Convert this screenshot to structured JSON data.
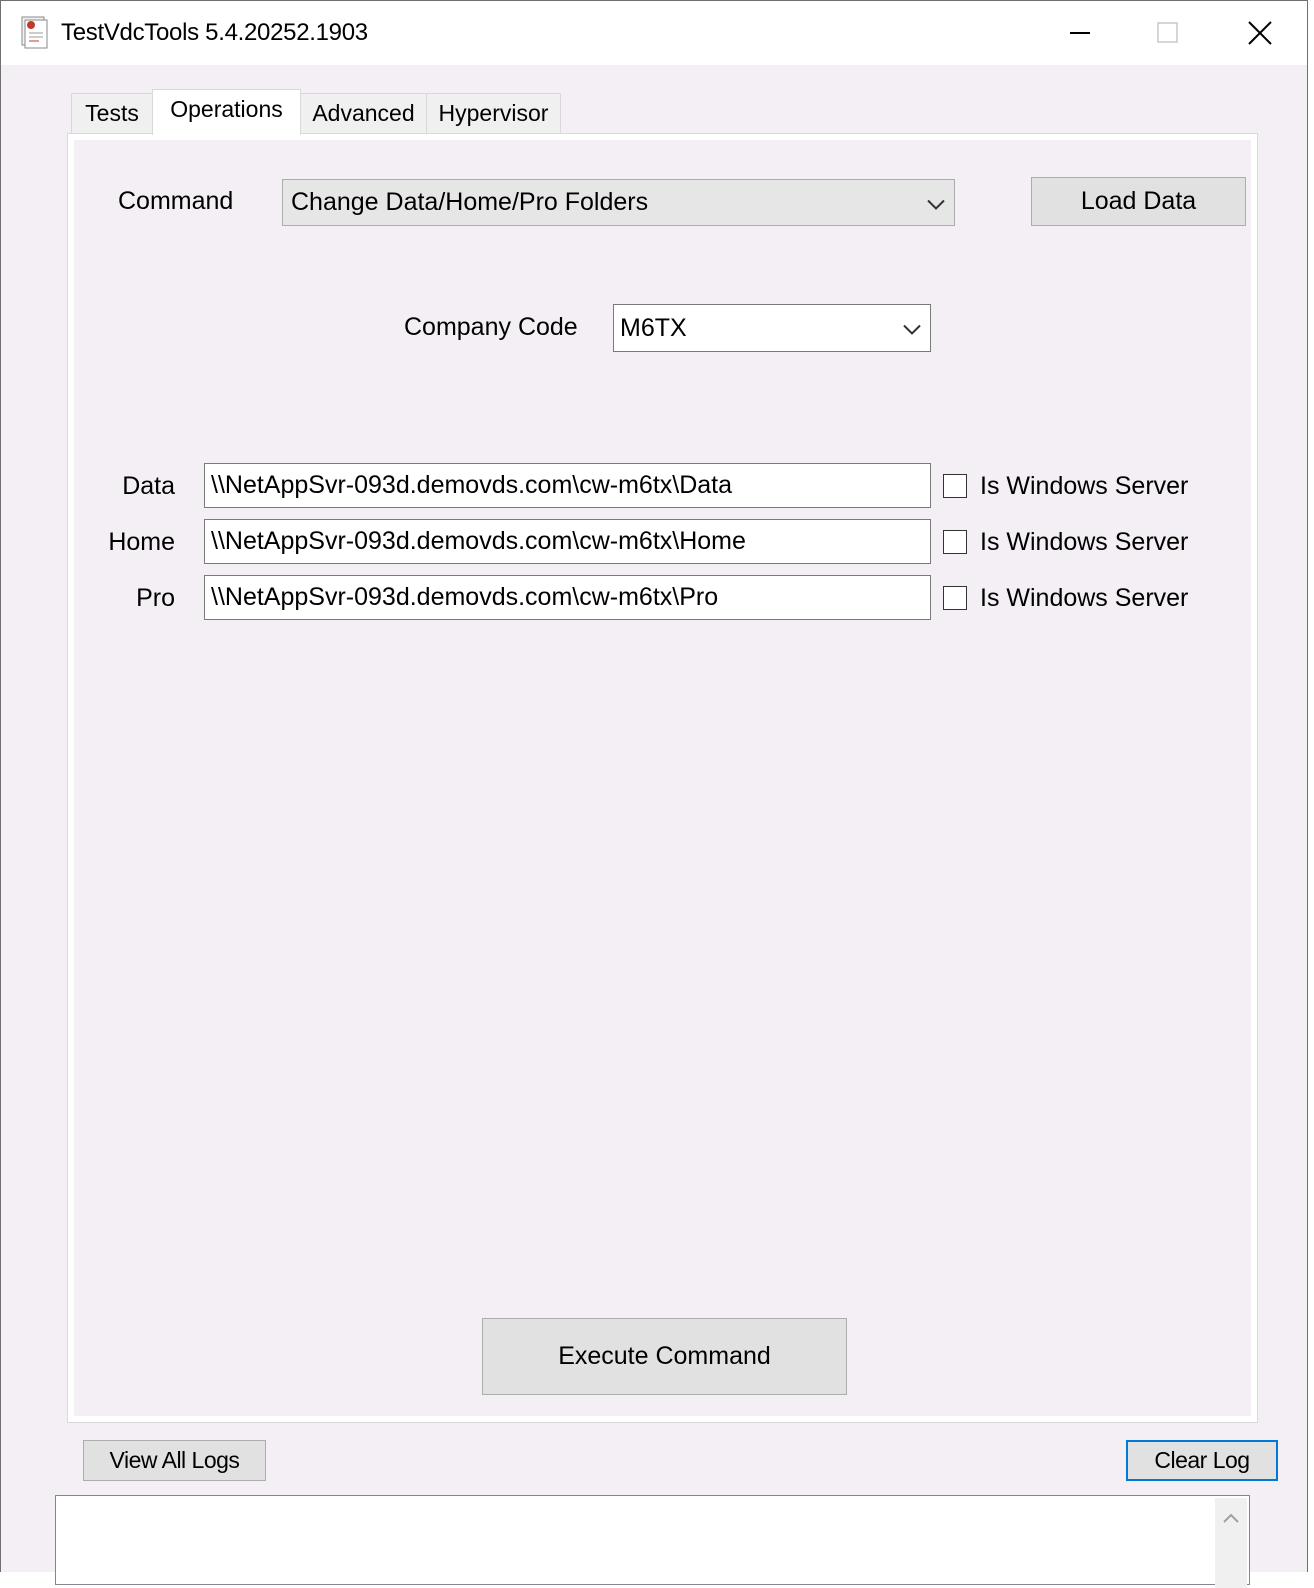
{
  "window": {
    "title": "TestVdcTools 5.4.20252.1903",
    "icons": {
      "app": "app-document-icon",
      "minimize": "minimize-icon",
      "maximize": "maximize-icon",
      "close": "close-icon"
    }
  },
  "tabs": [
    {
      "label": "Tests",
      "active": false
    },
    {
      "label": "Operations",
      "active": true
    },
    {
      "label": "Advanced",
      "active": false
    },
    {
      "label": "Hypervisor",
      "active": false
    }
  ],
  "operations": {
    "command_label": "Command",
    "command_value": "Change Data/Home/Pro Folders",
    "load_data_label": "Load Data",
    "company_code_label": "Company Code",
    "company_code_value": "M6TX",
    "folders": [
      {
        "label": "Data",
        "path": "\\\\NetAppSvr-093d.demovds.com\\cw-m6tx\\Data",
        "checkbox_label": "Is Windows Server",
        "checked": false
      },
      {
        "label": "Home",
        "path": "\\\\NetAppSvr-093d.demovds.com\\cw-m6tx\\Home",
        "checkbox_label": "Is Windows Server",
        "checked": false
      },
      {
        "label": "Pro",
        "path": "\\\\NetAppSvr-093d.demovds.com\\cw-m6tx\\Pro",
        "checkbox_label": "Is Windows Server",
        "checked": false
      }
    ],
    "execute_label": "Execute Command"
  },
  "log": {
    "view_all_label": "View All Logs",
    "clear_label": "Clear Log",
    "content": ""
  },
  "colors": {
    "window_bg": "#f4eff4",
    "button_bg": "#e1e1e1",
    "focus_border": "#0078d7"
  }
}
